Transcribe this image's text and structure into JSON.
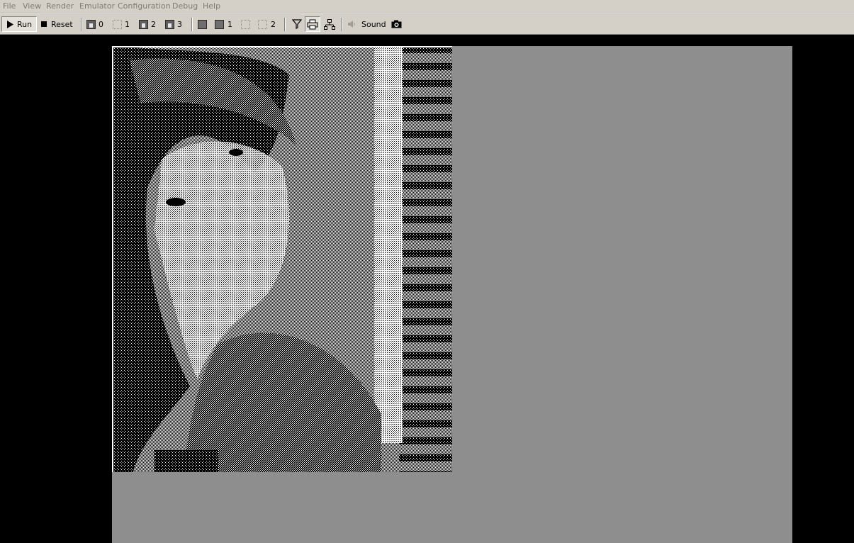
{
  "menu": {
    "file": "File",
    "view": "View",
    "render": "Render",
    "emulator": "Emulator",
    "configuration": "Configuration",
    "debug": "Debug",
    "help": "Help"
  },
  "toolbar": {
    "run_label": "Run",
    "reset_label": "Reset",
    "floppy0": "0",
    "floppy1": "1",
    "floppy2": "2",
    "floppy3": "3",
    "hdd1": "1",
    "hdd2": "2",
    "sound_label": "Sound",
    "icons": [
      "play-icon",
      "stop-icon",
      "floppy-icon",
      "hard-disk-icon",
      "filter-icon",
      "printer-icon",
      "network-icon",
      "speaker-icon",
      "camera-icon"
    ]
  },
  "colors": {
    "chrome": "#d4d0c8",
    "disabled_text": "#7e7b76",
    "emulator_background": "#8e8e8e",
    "desktop": "#000000"
  },
  "display": {
    "content": "dithered monochrome photograph of a woman"
  }
}
